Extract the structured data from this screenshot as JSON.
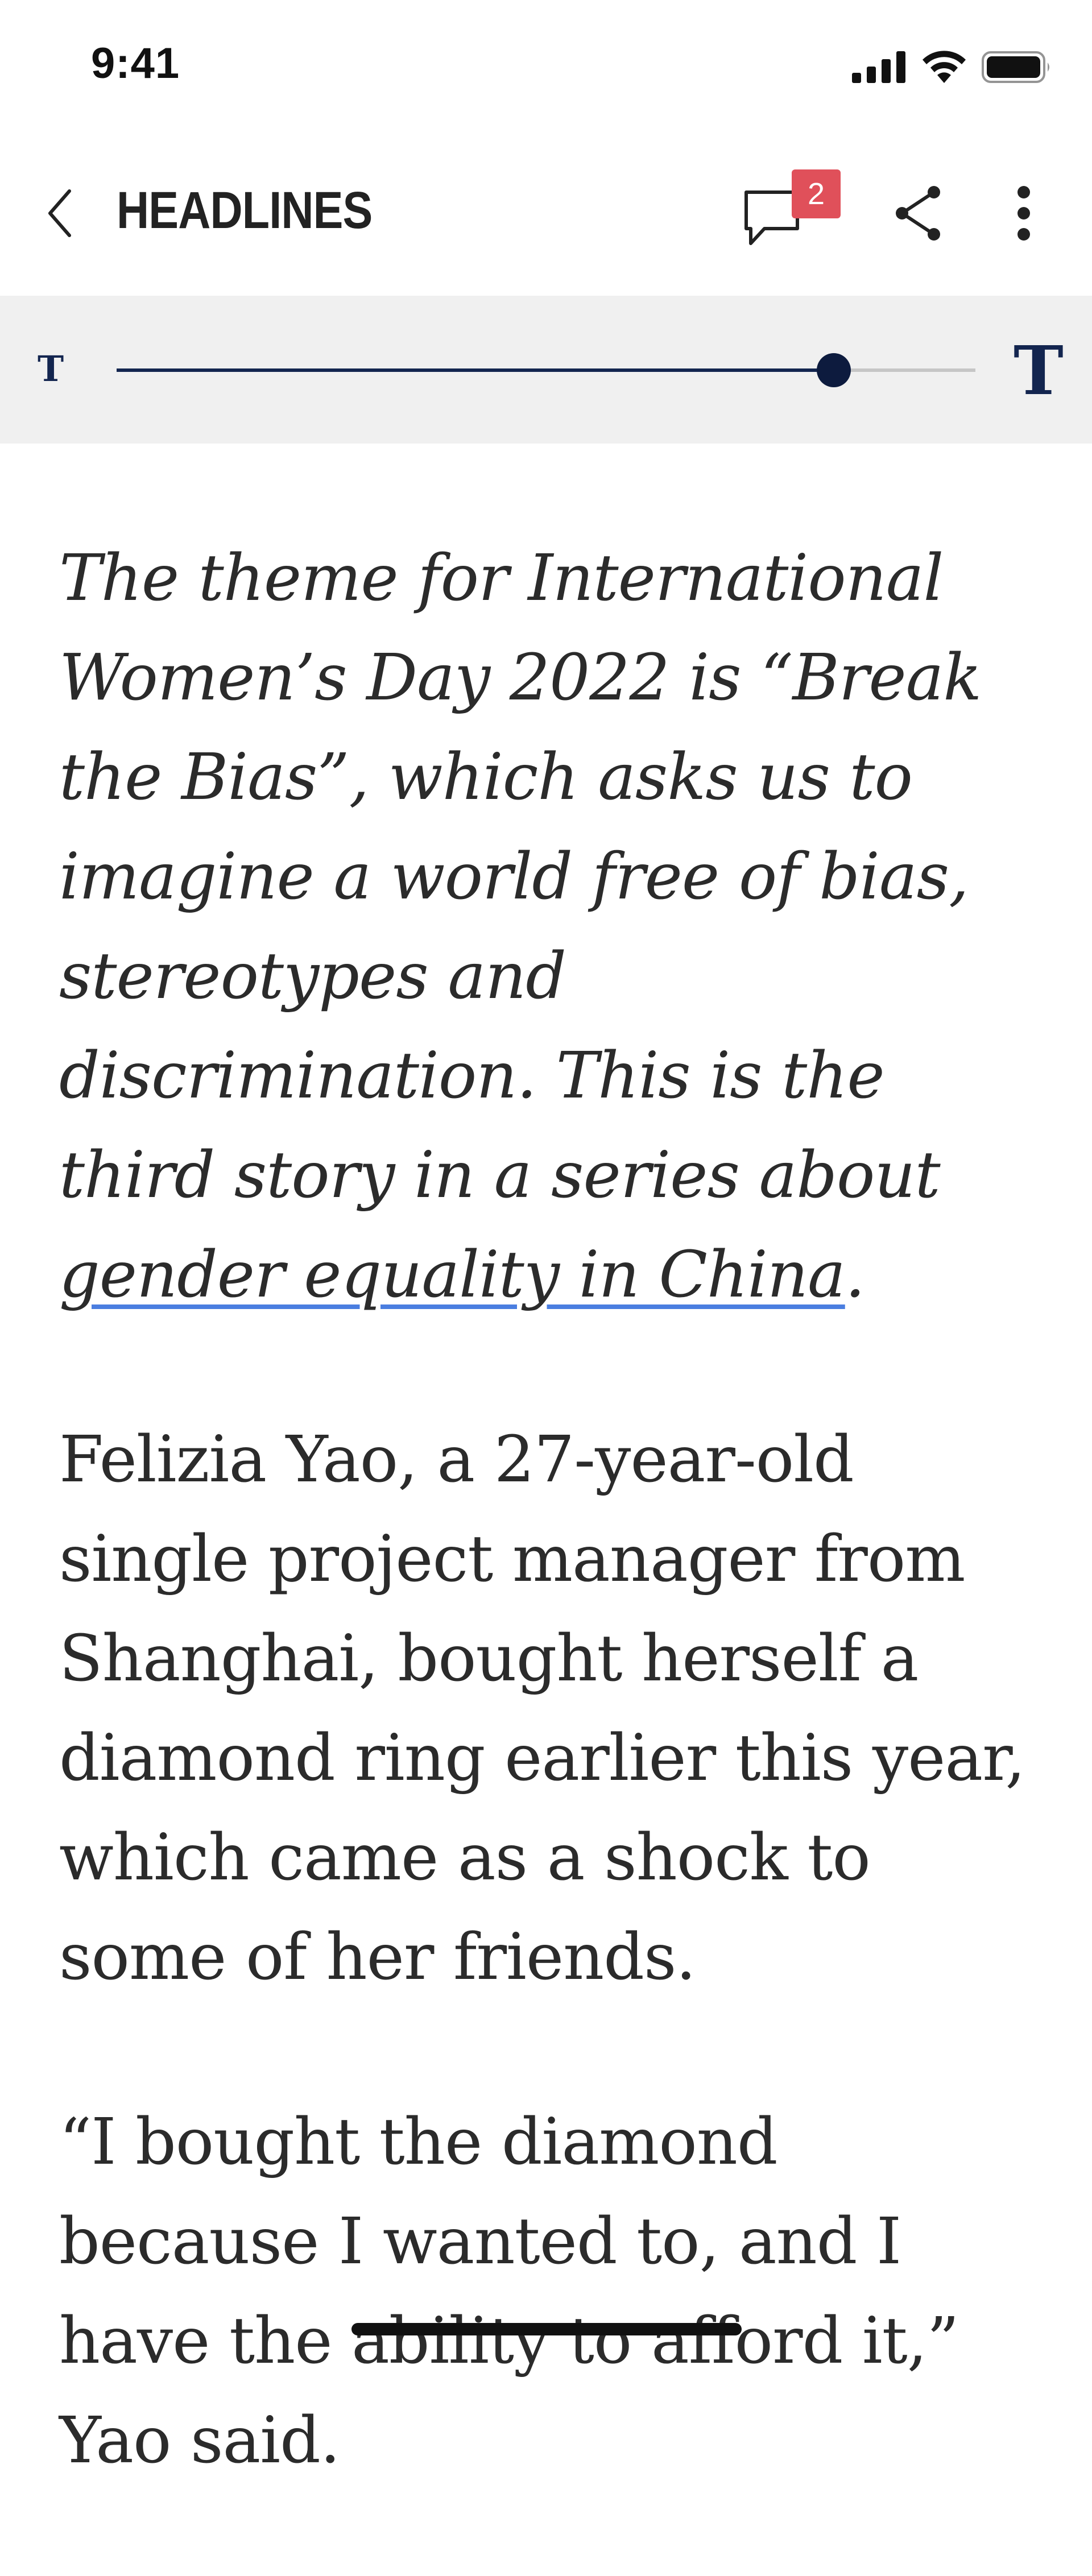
{
  "status_bar": {
    "time": "9:41"
  },
  "header": {
    "title": "HEADLINES",
    "comment_count": "2"
  },
  "font_size_control": {
    "small_label": "T",
    "large_label": "T",
    "level_fraction": 0.835
  },
  "article": {
    "intro_before_link": "The theme for International Women’s Day 2022 is “Break the Bias”, which asks us to imagine a world free of bias, stereotypes and discrimination. This is the third story in a series about ",
    "intro_link": "gender equality in China",
    "intro_after_link": ".",
    "paragraphs": [
      "Felizia Yao, a 27-year-old single project manager from Shanghai, bought herself a diamond ring earlier this year, which came as a shock to some of her friends.",
      "“I bought the diamond because I wanted to, and I have the ability to afford it,” Yao said."
    ]
  },
  "colors": {
    "accent_navy": "#13254f",
    "badge_red": "#e0505a",
    "link_underline": "#4a7ee0",
    "toolbar_bg": "#f0f0f0"
  },
  "icons": [
    "signal-icon",
    "wifi-icon",
    "battery-icon",
    "back-chevron-icon",
    "comment-icon",
    "share-icon",
    "more-vertical-icon"
  ]
}
